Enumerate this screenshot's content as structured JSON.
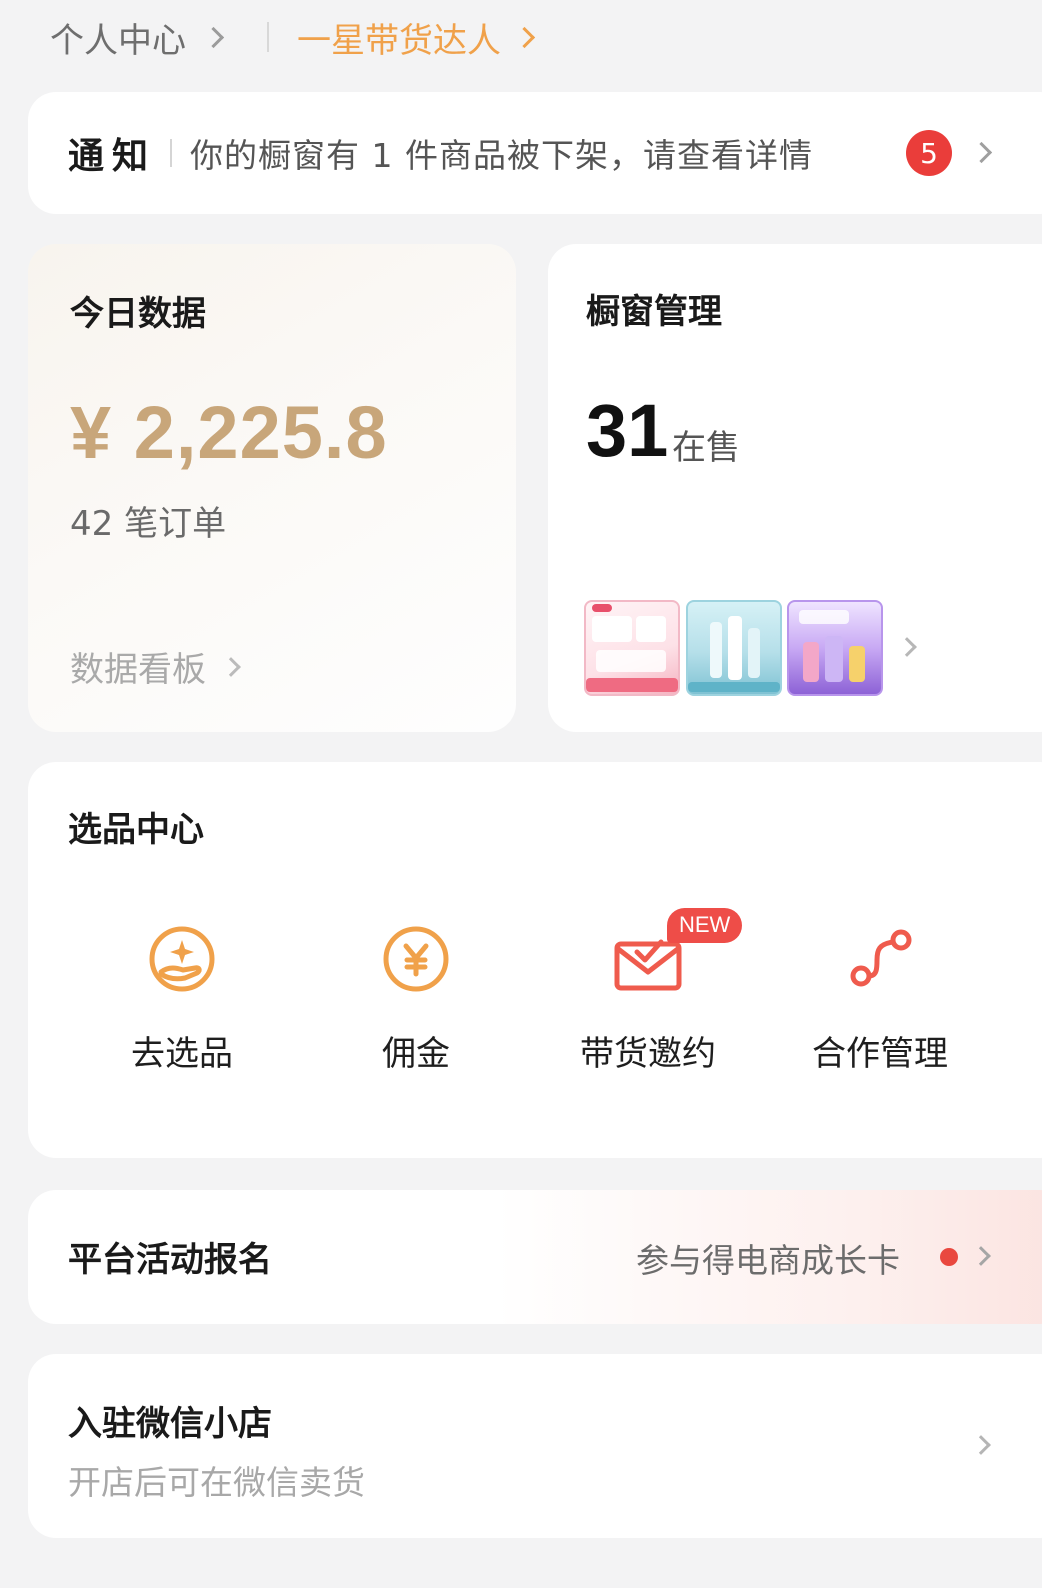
{
  "header": {
    "profile_label": "个人中心",
    "level_label": "一星带货达人"
  },
  "notice": {
    "tag": "通知",
    "message": "你的橱窗有 1 件商品被下架，请查看详情",
    "badge_count": "5"
  },
  "today": {
    "title": "今日数据",
    "amount": "¥ 2,225.8",
    "orders": "42 笔订单",
    "board_link": "数据看板"
  },
  "showcase": {
    "title": "橱窗管理",
    "count": "31",
    "count_label": "在售",
    "thumbnails": [
      "product-thumbnail-1",
      "product-thumbnail-2",
      "product-thumbnail-3"
    ]
  },
  "selection": {
    "title": "选品中心",
    "tools": [
      {
        "label": "去选品",
        "icon": "hand-star-icon"
      },
      {
        "label": "佣金",
        "icon": "yuan-coin-icon"
      },
      {
        "label": "带货邀约",
        "icon": "envelope-check-icon",
        "badge": "NEW"
      },
      {
        "label": "合作管理",
        "icon": "route-nodes-icon"
      }
    ]
  },
  "activity": {
    "title": "平台活动报名",
    "hint": "参与得电商成长卡"
  },
  "shop": {
    "title": "入驻微信小店",
    "subtitle": "开店后可在微信卖货"
  },
  "colors": {
    "accent": "#f0a14a",
    "amount": "#c8a67a",
    "badge": "#ea3d3a",
    "icon": "#f0a14a",
    "background": "#f3f3f4"
  }
}
